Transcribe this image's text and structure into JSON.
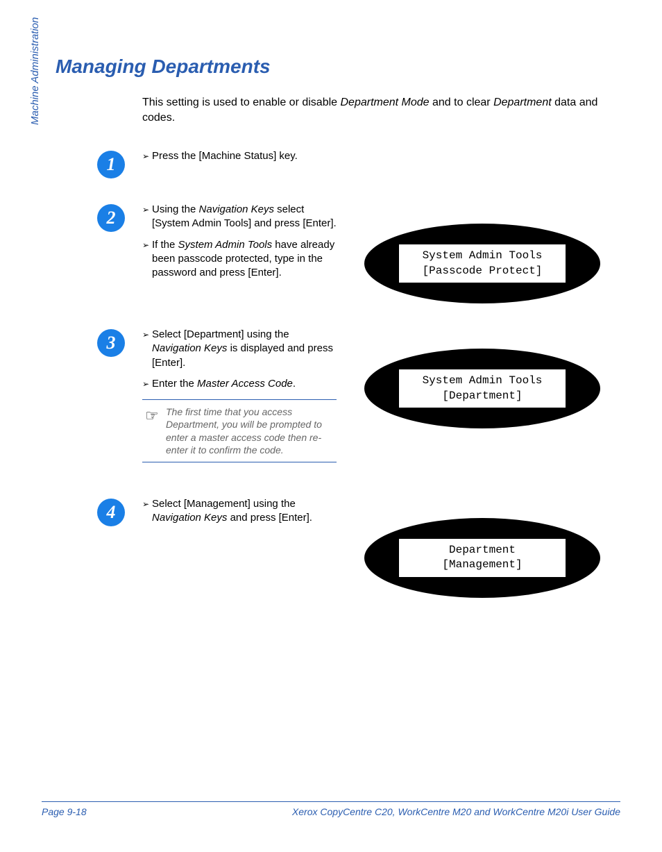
{
  "sideLabel": "Machine Administration",
  "title": "Managing Departments",
  "intro": {
    "part1": "This setting is used to enable or disable ",
    "ital1": "Department Mode",
    "part2": " and to clear ",
    "ital2": "Department",
    "part3": " data and codes."
  },
  "steps": {
    "s1": {
      "num": "1",
      "b1": "Press the [Machine Status] key."
    },
    "s2": {
      "num": "2",
      "b1a": "Using the ",
      "b1i": "Navigation Keys",
      "b1b": " select [System Admin Tools] and press [Enter].",
      "b2a": "If the ",
      "b2i": "System Admin Tools",
      "b2b": " have already been passcode protected, type in the password and press [Enter].",
      "lcd": {
        "l1": "System Admin Tools",
        "l2": "[Passcode Protect]"
      }
    },
    "s3": {
      "num": "3",
      "b1a": "Select [Department] using the ",
      "b1i": "Navigation Keys",
      "b1b": " is displayed and press [Enter].",
      "b2a": "Enter the ",
      "b2i": "Master Access Code",
      "b2b": ".",
      "note": "The first time that you access Department, you will be prompted to enter a master access code then re-enter it to confirm the code.",
      "lcd": {
        "l1": "System Admin Tools",
        "l2": "[Department]"
      }
    },
    "s4": {
      "num": "4",
      "b1a": "Select [Management] using the ",
      "b1i": "Navigation Keys",
      "b1b": " and press [Enter].",
      "lcd": {
        "l1": "Department",
        "l2": "[Management]"
      }
    }
  },
  "footer": {
    "left": "Page 9-18",
    "right": "Xerox CopyCentre C20, WorkCentre M20 and WorkCentre M20i User Guide"
  }
}
